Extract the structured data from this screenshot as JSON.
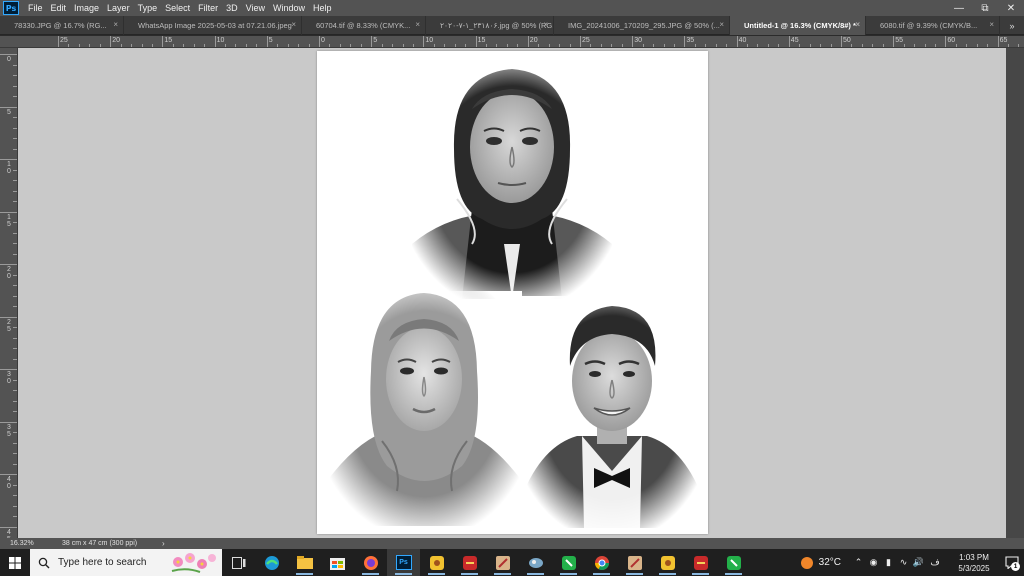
{
  "app": {
    "logo": "Ps",
    "menu": [
      "File",
      "Edit",
      "Image",
      "Layer",
      "Type",
      "Select",
      "Filter",
      "3D",
      "View",
      "Window",
      "Help"
    ],
    "window_controls": [
      "minimize-icon",
      "restore-icon",
      "close-icon"
    ]
  },
  "tabs": [
    {
      "label": "78330.JPG @ 16.7% (RG...",
      "active": false
    },
    {
      "label": "WhatsApp Image 2025-05-03 at 07.21.06.jpeg",
      "active": false
    },
    {
      "label": "60704.tif @ 8.33% (CMYK...",
      "active": false
    },
    {
      "label": "۲۰۲۰-۷-۱_۲۳۱۸۰۶.jpg @ 50% (RG...",
      "active": false
    },
    {
      "label": "IMG_20241006_170209_295.JPG @ 50% (...",
      "active": false
    },
    {
      "label": "Untitled-1 @ 16.3% (CMYK/8#) *",
      "active": true
    },
    {
      "label": "6080.tif @ 9.39% (CMYK/B...",
      "active": false
    }
  ],
  "tab_more": "»",
  "rulers": {
    "horizontal": [
      "25",
      "20",
      "15",
      "10",
      "5",
      "0",
      "5",
      "10",
      "15",
      "20",
      "25",
      "30",
      "35",
      "40",
      "45",
      "50",
      "55",
      "60",
      "65"
    ],
    "vertical": [
      "0",
      "5",
      "10",
      "15",
      "20",
      "25",
      "30",
      "35",
      "40",
      "45"
    ]
  },
  "status": {
    "zoom": "16.32%",
    "document": "38 cm x 47 cm (300 ppi)",
    "arrow": "›"
  },
  "taskbar": {
    "search_placeholder": "Type here to search",
    "apps": [
      "task-view-icon",
      "edge-icon",
      "file-explorer-icon",
      "store-icon",
      "firefox-icon",
      "photoshop-icon",
      "app-icon",
      "app-icon",
      "app-icon",
      "app-icon",
      "app-icon",
      "chrome-icon",
      "app-icon",
      "app-icon",
      "app-icon",
      "app-icon"
    ],
    "weather_temp": "32°C",
    "language": "ف",
    "time": "1:03 PM",
    "date": "5/3/2025",
    "notifications": "1"
  },
  "colors": {
    "menu_bg": "#535353",
    "tab_bg": "#3b3b3b",
    "canvas_bg": "#c9c9c9",
    "taskbar_bg": "#1f1f1f",
    "accent": "#31a8ff"
  }
}
